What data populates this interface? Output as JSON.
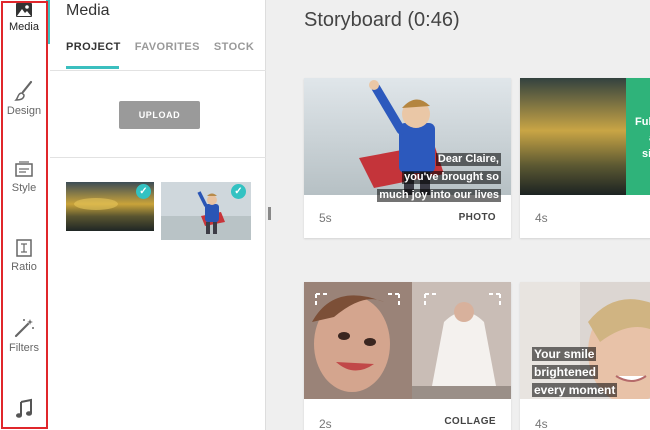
{
  "rail": {
    "items": [
      {
        "label": "Media",
        "icon": "image-icon"
      },
      {
        "label": "Design",
        "icon": "brush-icon"
      },
      {
        "label": "Style",
        "icon": "style-icon"
      },
      {
        "label": "Ratio",
        "icon": "ratio-icon"
      },
      {
        "label": "Filters",
        "icon": "magic-wand-icon"
      },
      {
        "label": "",
        "icon": "music-note-icon"
      }
    ]
  },
  "media": {
    "title": "Media",
    "tabs": [
      "PROJECT",
      "FAVORITES",
      "STOCK"
    ],
    "upload_label": "UPLOAD"
  },
  "storyboard": {
    "title": "Storyboard (0:46)",
    "cards": [
      {
        "duration": "5s",
        "kind": "PHOTO",
        "caption": [
          "Dear Claire,",
          "you've brought so",
          "much joy into our lives"
        ]
      },
      {
        "duration": "4s",
        "kind": "",
        "caption": [
          "Ful",
          "a",
          "si"
        ]
      },
      {
        "duration": "2s",
        "kind": "COLLAGE",
        "caption": []
      },
      {
        "duration": "4s",
        "kind": "",
        "caption": [
          "Your smile",
          "brightened",
          "every moment"
        ]
      }
    ]
  },
  "colors": {
    "accent": "#3bbfbf",
    "highlight_outline": "#e0262b",
    "green_tile": "#2fb37a"
  }
}
